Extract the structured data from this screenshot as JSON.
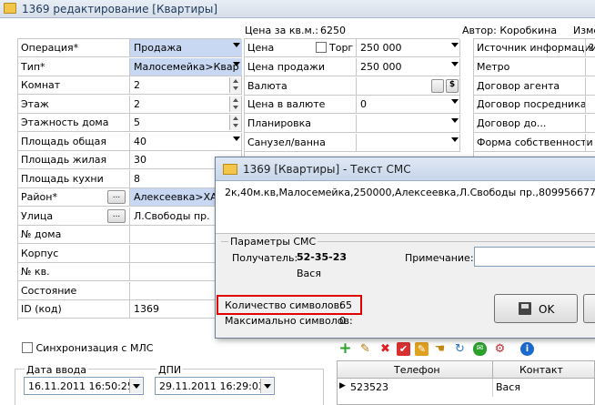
{
  "window": {
    "title": "1369 редактирование [Квартиры]"
  },
  "top_info": {
    "price_per_m2_label": "Цена за кв.м.:",
    "price_per_m2_value": "6250",
    "author_label": "Автор: Коробкина",
    "changed_label": "Изме"
  },
  "left_form": [
    {
      "label": "Операция*",
      "value": "Продажа",
      "kind": "select",
      "highlight": true
    },
    {
      "label": "Тип*",
      "value": "Малосемейка>Квар",
      "kind": "select",
      "highlight": true
    },
    {
      "label": "Комнат",
      "value": "2",
      "kind": "spin"
    },
    {
      "label": "Этаж",
      "value": "2",
      "kind": "spin"
    },
    {
      "label": "Этажность дома",
      "value": "5",
      "kind": "spin"
    },
    {
      "label": "Площадь общая",
      "value": "40",
      "kind": "select"
    },
    {
      "label": "Площадь жилая",
      "value": "30",
      "kind": "text"
    },
    {
      "label": "Площадь кухни",
      "value": "8",
      "kind": "text"
    },
    {
      "label": "Район*",
      "value": "Алексеевка>ХАРЬ",
      "kind": "lookup",
      "highlight": true
    },
    {
      "label": "Улица",
      "value": "Л.Свободы пр.",
      "kind": "lookup"
    },
    {
      "label": "№ дома",
      "value": "",
      "kind": "text"
    },
    {
      "label": "Корпус",
      "value": "",
      "kind": "text"
    },
    {
      "label": "№ кв.",
      "value": "",
      "kind": "text"
    },
    {
      "label": "Состояние",
      "value": "",
      "kind": "text"
    },
    {
      "label": "ID (код)",
      "value": "1369",
      "kind": "text"
    }
  ],
  "lookup_button": "...",
  "mid_form": [
    {
      "label": "Цена",
      "value": "250 000",
      "kind": "select",
      "torg": "Торг"
    },
    {
      "label": "Цена продажи",
      "value": "250 000",
      "kind": "select"
    },
    {
      "label": "Валюта",
      "value": "",
      "kind": "currency",
      "currency_symbol": "$"
    },
    {
      "label": "Цена в валюте",
      "value": "0",
      "kind": "select"
    },
    {
      "label": "Планировка",
      "value": "",
      "kind": "select"
    },
    {
      "label": "Санузел/ванна",
      "value": "",
      "kind": "select"
    }
  ],
  "right_form": [
    {
      "label": "Источник информации*",
      "value": "?"
    },
    {
      "label": "Метро",
      "value": ""
    },
    {
      "label": "Договор агента",
      "value": ""
    },
    {
      "label": "Договор посредника",
      "value": ""
    },
    {
      "label": "Договор до...",
      "value": ""
    },
    {
      "label": "Форма собственности",
      "value": ""
    }
  ],
  "sync_label": "Синхронизация с МЛС",
  "date_input": {
    "label": "Дата ввода",
    "value": "16.11.2011 16:50:25"
  },
  "dpi": {
    "label": "ДПИ",
    "value": "29.11.2011 16:29:03"
  },
  "dialog": {
    "title": "1369 [Квартиры] - Текст СМС",
    "sms_text": "2к,40м.кв,Малосемейка,250000,Алексеевка,Л.Свободы пр.,80995667717",
    "params_group": "Параметры СМС",
    "recipient_label": "Получатель:",
    "recipient_phone": "52-35-23",
    "recipient_name": "Вася",
    "note_label": "Примечание:",
    "char_count_label": "Количество символов:",
    "char_count_value": "65",
    "max_chars_label": "Максимально символов:",
    "max_chars_value": "0",
    "ok_label": "OK"
  },
  "phones_table": {
    "columns": [
      "Телефон",
      "Контакт"
    ],
    "rows": [
      {
        "phone": "523523",
        "contact": "Вася"
      }
    ]
  },
  "toolbar_icons": [
    "add-icon",
    "edit-icon",
    "delete-icon",
    "check-icon",
    "pen-icon",
    "hand-icon",
    "refresh-icon",
    "sms-icon",
    "settings-icon",
    "info-icon"
  ],
  "colors": {
    "highlight": "#c8d8f2",
    "alert_red": "#e00000",
    "title_bar": "#d6dfea"
  }
}
